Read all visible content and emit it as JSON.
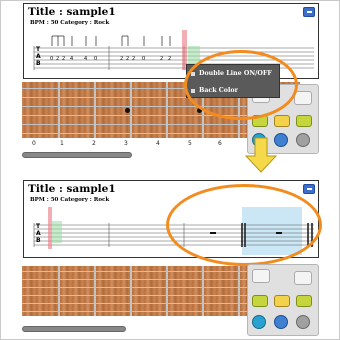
{
  "top": {
    "title": "Title : sample1",
    "meta": "BPM : 50    Category : Rock",
    "tab_letters": [
      "T",
      "A",
      "B"
    ],
    "tab_numbers": [
      "0",
      "2",
      "2",
      "4",
      "4",
      "0",
      "2",
      "2",
      "2",
      "0",
      "2",
      "2",
      "1"
    ],
    "popup": {
      "item1": "Double Line ON/OFF",
      "item2": "Back Color"
    }
  },
  "bottom": {
    "title": "Title : sample1",
    "meta": "BPM : 50    Category : Rock",
    "tab_letters": [
      "T",
      "A",
      "B"
    ]
  },
  "fret_numbers": [
    "0",
    "1",
    "2",
    "3",
    "4",
    "5",
    "6",
    "7"
  ],
  "colors": {
    "orange": "#f28c1e",
    "blue_button": "#3d6ec9",
    "highlight_blue": "#a0d2eb",
    "arrow_yellow": "#f6d94a"
  },
  "icons": [
    "menu-icon",
    "arrow-left-icon",
    "arrow-right-icon",
    "shuffle-icon",
    "list-icon",
    "play-icon",
    "power-icon",
    "gear-icon"
  ]
}
